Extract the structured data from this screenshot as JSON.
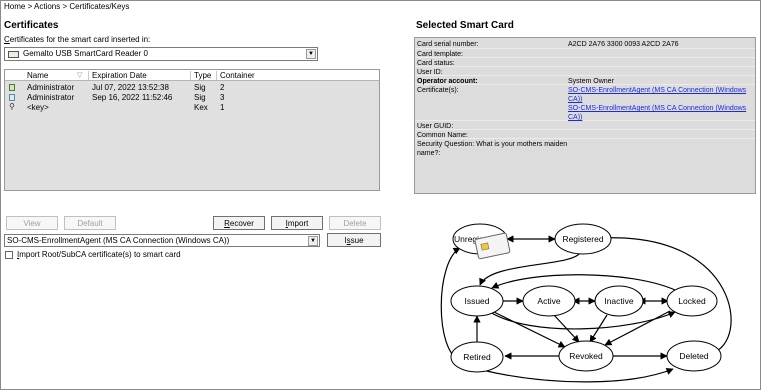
{
  "breadcrumb": "Home > Actions > Certificates/Keys",
  "certificates_section": {
    "title": "Certificates",
    "reader_label": "Certificates for the smart card inserted in:",
    "reader_label_first": "C",
    "reader_label_rest": "ertificates for the smart card inserted in:",
    "reader_value": "Gemalto USB SmartCard Reader 0",
    "columns": [
      "Name",
      "Expiration Date",
      "Type",
      "Container"
    ],
    "rows": [
      {
        "icon": "certificate-icon",
        "name": "Administrator",
        "expiration": "Jul 07, 2022 13:52:38",
        "type": "Sig",
        "container": "2"
      },
      {
        "icon": "certificate-icon",
        "name": "Administrator",
        "expiration": "Sep 16, 2022 11:52:46",
        "type": "Sig",
        "container": "3"
      },
      {
        "icon": "key-icon",
        "name": "<key>",
        "expiration": "",
        "type": "Kex",
        "container": "1"
      }
    ],
    "buttons": {
      "view": "View",
      "default": "Default",
      "recover_first": "R",
      "recover_rest": "ecover",
      "import_first": "I",
      "import_rest": "mport",
      "delete": "Delete",
      "issue_pre": "I",
      "issue_first": "s",
      "issue_rest": "sue"
    },
    "ca_select_value": "SO-CMS-EnrollmentAgent (MS CA Connection (Windows CA))",
    "import_root_first": "I",
    "import_root_rest": "mport Root/SubCA certificate(s) to smart card",
    "import_root_checked": false
  },
  "smart_card": {
    "title": "Selected Smart Card",
    "fields": [
      {
        "key": "Card serial number:",
        "value": "A2CD 2A76 3300 0093 A2CD 2A76"
      },
      {
        "key": "Card template:",
        "value": ""
      },
      {
        "key": "Card status:",
        "value": ""
      },
      {
        "key": "User ID:",
        "value": ""
      },
      {
        "key": "Operator account:",
        "value": "System Owner"
      },
      {
        "key": "Certificate(s):",
        "value": "SO-CMS-EnrollmentAgent (MS CA Connection (Windows CA))",
        "value2": "SO-CMS-EnrollmentAgent (MS CA Connection (Windows CA))"
      },
      {
        "key": "User GUID:",
        "value": ""
      },
      {
        "key": "Common Name:",
        "value": ""
      },
      {
        "key": "Security Question: What is your mothers maiden name?:",
        "value": ""
      }
    ]
  },
  "lifecycle": {
    "states": [
      "Unregistered",
      "Registered",
      "Issued",
      "Active",
      "Inactive",
      "Locked",
      "Retired",
      "Revoked",
      "Deleted"
    ],
    "unregistered_visible": "Unregis"
  },
  "colors": {
    "link": "#1a2ae0",
    "list_bg": "#e0e0e0",
    "panel_bg": "#dcdcdc",
    "card_chip": "#e8c84a"
  }
}
